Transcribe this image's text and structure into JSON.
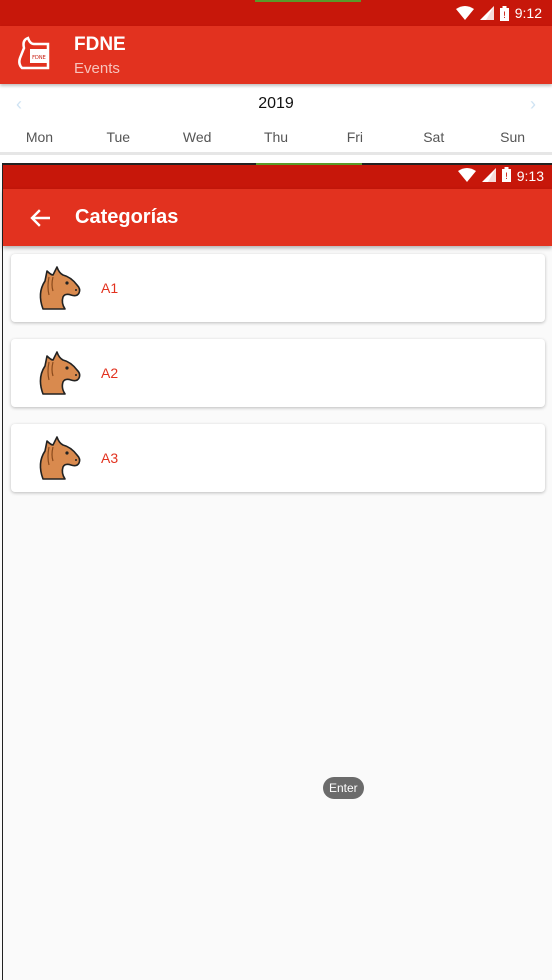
{
  "colors": {
    "status_bar": "#c7170a",
    "app_bar": "#e2321f",
    "accent_text": "#e2321f"
  },
  "back_screen": {
    "status": {
      "icons": [
        "wifi-icon",
        "signal-icon",
        "battery-icon"
      ],
      "time": "9:12"
    },
    "app_bar": {
      "logo": "fdne-logo",
      "title": "FDNE",
      "subtitle": "Events"
    },
    "calendar": {
      "year": "2019",
      "prev_icon": "chevron-left-icon",
      "next_icon": "chevron-right-icon",
      "weekdays": [
        "Mon",
        "Tue",
        "Wed",
        "Thu",
        "Fri",
        "Sat",
        "Sun"
      ]
    }
  },
  "front_screen": {
    "status": {
      "icons": [
        "wifi-icon",
        "signal-icon",
        "battery-icon"
      ],
      "time": "9:13"
    },
    "app_bar": {
      "back_icon": "back-arrow-icon",
      "title": "Categorías"
    },
    "categories": [
      {
        "label": "A1",
        "icon": "horse-head-icon"
      },
      {
        "label": "A2",
        "icon": "horse-head-icon"
      },
      {
        "label": "A3",
        "icon": "horse-head-icon"
      }
    ],
    "toast": "Enter"
  }
}
